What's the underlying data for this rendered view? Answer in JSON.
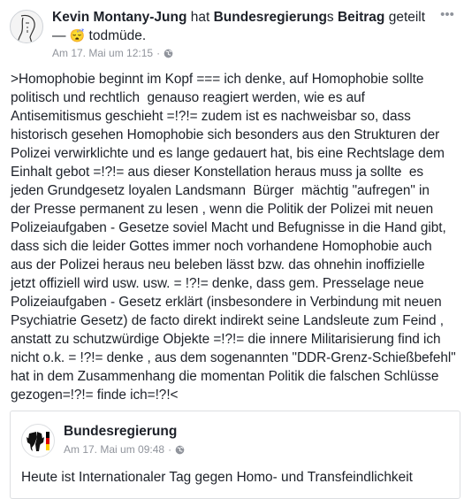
{
  "post": {
    "author": "Kevin Montany-Jung",
    "verb_hat": " hat ",
    "shared_page": "Bundesregierung",
    "possessive_suffix": "s ",
    "post_word": "Beitrag",
    "verb_shared": " geteilt",
    "dash": " — ",
    "feeling_emoji": "😴",
    "feeling": " todmüde.",
    "timestamp": "Am 17. Mai um 12:15",
    "dot": "·",
    "more_icon": "•••",
    "text": ">Homophobie beginnt im Kopf === ich denke, auf Homophobie sollte\npolitisch und rechtlich  genauso reagiert werden, wie es auf\nAntisemitismus geschieht =!?!= zudem ist es nachweisbar so, dass\nhistorisch gesehen Homophobie sich besonders aus den Strukturen der\nPolizei verwirklichte und es lange gedauert hat, bis eine Rechtslage dem\nEinhalt gebot =!?!= aus dieser Konstellation heraus muss ja sollte  es\njeden Grundgesetz loyalen Landsmann  Bürger  mächtig \"aufregen\" in\nder Presse permanent zu lesen , wenn die Politik der Polizei mit neuen\nPolizeiaufgaben - Gesetze soviel Macht und Befugnisse in die Hand gibt,\ndass sich die leider Gottes immer noch vorhandene Homophobie auch\naus der Polizei heraus neu beleben lässt bzw. das ohnehin inoffizielle\njetzt offiziell wird usw. usw. = !?!= denke, dass gem. Presselage neue\nPolizeiaufgaben - Gesetz erklärt (insbesondere in Verbindung mit neuen\nPsychiatrie Gesetz) de facto direkt indirekt seine Landsleute zum Feind ,\nanstatt zu schutzwürdige Objekte =!?!= die innere Militarisierung find ich\nnicht o.k. = !?!= denke , aus dem sogenannten \"DDR-Grenz-Schießbefehl\"\nhat in dem Zusammenhang die momentan Politik die falschen Schlüsse\ngezogen=!?!= finde ich=!?!<"
  },
  "shared": {
    "name": "Bundesregierung",
    "timestamp": "Am 17. Mai um 09:48",
    "dot": "·",
    "text": "Heute ist Internationaler Tag gegen Homo- und Transfeindlichkeit"
  },
  "colors": {
    "text": "#1d2129",
    "meta": "#90949c",
    "border": "#dddfe2",
    "flag_black": "#000000",
    "flag_red": "#dd0000",
    "flag_gold": "#ffce00"
  }
}
